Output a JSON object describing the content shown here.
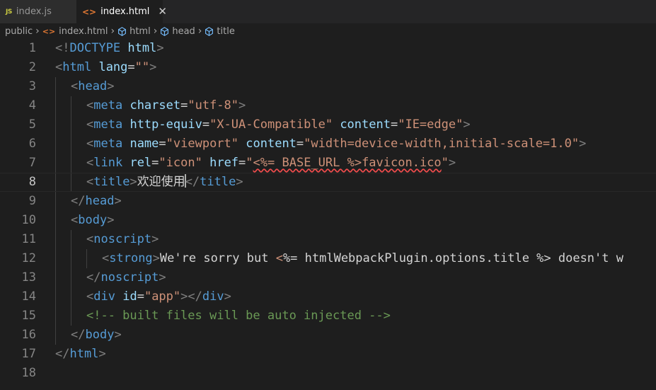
{
  "tabs": [
    {
      "icon": "JS",
      "label": "index.js",
      "active": false
    },
    {
      "icon": "<>",
      "label": "index.html",
      "active": true,
      "close": "✕"
    }
  ],
  "breadcrumb": [
    "public",
    "index.html",
    "html",
    "head",
    "title"
  ],
  "current_line": 8,
  "line_numbers": [
    "1",
    "2",
    "3",
    "4",
    "5",
    "6",
    "7",
    "8",
    "9",
    "10",
    "11",
    "12",
    "13",
    "14",
    "15",
    "16",
    "17",
    "18"
  ],
  "code": {
    "l1": [
      "<!",
      "DOCTYPE",
      " ",
      "html",
      ">"
    ],
    "l2": [
      "<",
      "html",
      " ",
      "lang",
      "=",
      "\"\"",
      ">"
    ],
    "l3": [
      "<",
      "head",
      ">"
    ],
    "l4": [
      "<",
      "meta",
      " ",
      "charset",
      "=",
      "\"utf-8\"",
      ">"
    ],
    "l5": [
      "<",
      "meta",
      " ",
      "http-equiv",
      "=",
      "\"X-UA-Compatible\"",
      " ",
      "content",
      "=",
      "\"IE=edge\"",
      ">"
    ],
    "l6": [
      "<",
      "meta",
      " ",
      "name",
      "=",
      "\"viewport\"",
      " ",
      "content",
      "=",
      "\"width=device-width,initial-scale=1.0\"",
      ">"
    ],
    "l7": [
      "<",
      "link",
      " ",
      "rel",
      "=",
      "\"icon\"",
      " ",
      "href",
      "=",
      "\"",
      "<%= BASE_URL %>favicon.ico",
      "\"",
      ">"
    ],
    "l8": [
      "<",
      "title",
      ">",
      "欢迎使用",
      "</",
      "title",
      ">"
    ],
    "l9": [
      "</",
      "head",
      ">"
    ],
    "l10": [
      "<",
      "body",
      ">"
    ],
    "l11": [
      "<",
      "noscript",
      ">"
    ],
    "l12": [
      "<",
      "strong",
      ">",
      "We're sorry but ",
      "<",
      "%= htmlWebpackPlugin.options.title %> doesn't w"
    ],
    "l13": [
      "</",
      "noscript",
      ">"
    ],
    "l14": [
      "<",
      "div",
      " ",
      "id",
      "=",
      "\"app\"",
      "></",
      "div",
      ">"
    ],
    "l15": [
      "<!-- built files will be auto injected -->"
    ],
    "l16": [
      "</",
      "body",
      ">"
    ],
    "l17": [
      "</",
      "html",
      ">"
    ]
  }
}
